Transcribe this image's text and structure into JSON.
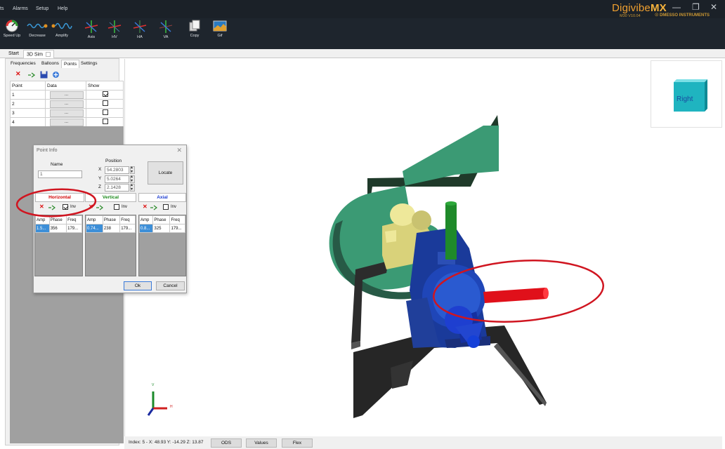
{
  "menu": [
    "ts",
    "Alarms",
    "Setup",
    "Help"
  ],
  "brand": {
    "name_a": "Digivibe",
    "name_b": "MX",
    "version": "M30 V10.04",
    "company": "☉ DMESSO INSTRUMENTS"
  },
  "ribbon": [
    {
      "label": "Speed Up",
      "icon": "gauge-icon"
    },
    {
      "label": "Decrease",
      "icon": "wave-decrease-icon"
    },
    {
      "label": "Amplify",
      "icon": "wave-amplify-icon"
    },
    {
      "label": "Axis",
      "icon": "axis-icon"
    },
    {
      "label": "HV",
      "icon": "hv-axis-icon"
    },
    {
      "label": "HA",
      "icon": "ha-axis-icon"
    },
    {
      "label": "VA",
      "icon": "va-axis-icon"
    },
    {
      "label": "Copy",
      "icon": "copy-icon"
    },
    {
      "label": "Gif",
      "icon": "gif-icon"
    }
  ],
  "doc_tabs": [
    "Start",
    "3D Sim"
  ],
  "sub_tabs": [
    "Frequencies",
    "Balloons",
    "Points",
    "Settings"
  ],
  "points_table": {
    "headers": [
      "Point",
      "Data",
      "Show"
    ],
    "rows": [
      {
        "point": "1",
        "data": "...",
        "show": true
      },
      {
        "point": "2",
        "data": "...",
        "show": false
      },
      {
        "point": "3",
        "data": "...",
        "show": false
      },
      {
        "point": "4",
        "data": "...",
        "show": false
      }
    ]
  },
  "dialog": {
    "title": "Point Info",
    "name_label": "Name",
    "name_value": "1",
    "position_label": "Position",
    "x_label": "X",
    "x_value": "54.2803",
    "y_label": "Y",
    "y_value": "5.0264",
    "z_label": "Z",
    "z_value": "2.1428",
    "locate": "Locate",
    "axes": [
      {
        "name": "Horizontal",
        "color": "#d10000",
        "inv_checked": true,
        "inv_label": "Inv",
        "cols": [
          "Amp",
          "Phase",
          "Freq"
        ],
        "row": [
          "1.5...",
          "356",
          "179..."
        ]
      },
      {
        "name": "Vertical",
        "color": "#1a8a1a",
        "inv_checked": false,
        "inv_label": "Inv",
        "cols": [
          "Amp",
          "Phase",
          "Freq"
        ],
        "row": [
          "0.74...",
          "238",
          "179..."
        ]
      },
      {
        "name": "Axial",
        "color": "#1a3ad0",
        "inv_checked": false,
        "inv_label": "Inv",
        "cols": [
          "Amp",
          "Phase",
          "Freq"
        ],
        "row": [
          "0.8...",
          "325",
          "179..."
        ]
      }
    ],
    "ok": "Ok",
    "cancel": "Cancel"
  },
  "viewcube": {
    "face_label": "Right"
  },
  "axes_gizmo": {
    "v_label": "V",
    "h_label": "H"
  },
  "status": {
    "text": "Index: 5 - X: 48.93 Y: -14.29 Z: 13.87",
    "buttons": [
      "ODS",
      "Values",
      "Flex"
    ]
  }
}
